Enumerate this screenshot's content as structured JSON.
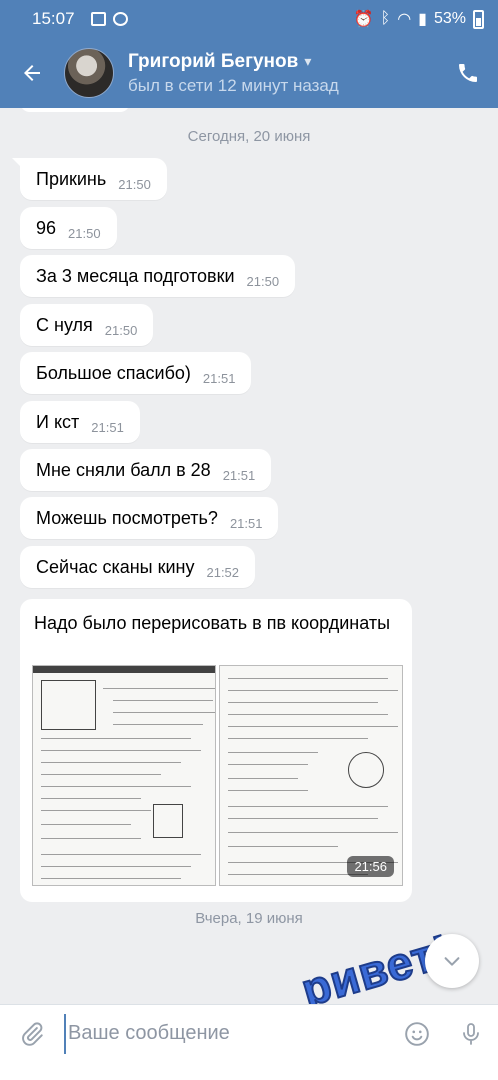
{
  "status_bar": {
    "time": "15:07",
    "battery": "53%"
  },
  "header": {
    "back_icon": "arrow-left-icon",
    "name": "Григорий Бегунов",
    "status": "был в сети 12 минут назад",
    "call_icon": "phone-icon"
  },
  "chat": {
    "date_top": "Сегодня, 20 июня",
    "messages": [
      {
        "text": "Прикинь",
        "time": "21:50"
      },
      {
        "text": "96",
        "time": "21:50"
      },
      {
        "text": "За 3 месяца подготовки",
        "time": "21:50"
      },
      {
        "text": "С нуля",
        "time": "21:50"
      },
      {
        "text": "Большое спасибо)",
        "time": "21:51"
      },
      {
        "text": "И кст",
        "time": "21:51"
      },
      {
        "text": "Мне сняли балл в 28",
        "time": "21:51"
      },
      {
        "text": "Можешь посмотреть?",
        "time": "21:51"
      },
      {
        "text": "Сейчас сканы кину",
        "time": "21:52"
      }
    ],
    "photo_message": {
      "text": "Надо было перерисовать в пв координаты",
      "time": "21:56"
    },
    "date_bottom": "Вчера, 19 июня",
    "sticker_text": "ривет!"
  },
  "input": {
    "placeholder": "Ваше сообщение"
  },
  "colors": {
    "accent": "#5181b8",
    "background": "#edeef0",
    "bubble": "#ffffff"
  }
}
